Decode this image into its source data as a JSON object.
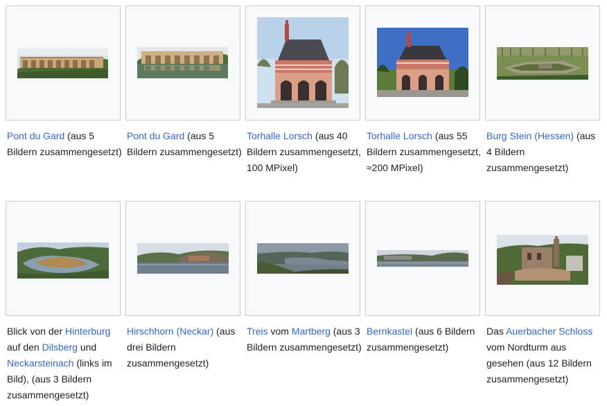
{
  "colors": {
    "link": "#3366cc",
    "text": "#202122",
    "thumb_bg": "#f8f9fa",
    "thumb_border": "#c8ccd1"
  },
  "gallery": {
    "items": [
      {
        "id": "pont-du-gard-5-a",
        "image": "pont-du-gard-panorama",
        "caption": {
          "link1": "Pont du Gard",
          "rest": " (aus 5 Bildern zusammengesetzt)"
        }
      },
      {
        "id": "pont-du-gard-5-b",
        "image": "pont-du-gard-panorama-reflection",
        "caption": {
          "link1": "Pont du Gard",
          "rest": " (aus 5 Bildern zusammengesetzt)"
        }
      },
      {
        "id": "torhalle-lorsch-40",
        "image": "torhalle-lorsch-photo",
        "caption": {
          "link1": "Torhalle Lorsch",
          "rest": " (aus 40 Bildern zusammengesetzt, 100 MPixel)"
        }
      },
      {
        "id": "torhalle-lorsch-55",
        "image": "torhalle-lorsch-photo-blue-sky",
        "caption": {
          "link1": "Torhalle Lorsch",
          "rest": " (aus 55 Bildern zusammengesetzt, ≈200 MPixel)"
        }
      },
      {
        "id": "burg-stein",
        "image": "burg-stein-ruins-panorama",
        "caption": {
          "link1": "Burg Stein (Hessen)",
          "rest": " (aus 4 Bildern zusammengesetzt)"
        }
      },
      {
        "id": "blick-hinterburg",
        "image": "neckar-bend-panorama",
        "caption": {
          "pre": "Blick von der ",
          "link1": "Hinterburg",
          "mid1": " auf den ",
          "link2": "Dilsberg",
          "mid2": " und ",
          "link3": "Neckarsteinach",
          "rest": " (links im Bild), (aus 3 Bildern zusammengesetzt)"
        }
      },
      {
        "id": "hirschhorn",
        "image": "hirschhorn-river-panorama",
        "caption": {
          "link1": "Hirschhorn (Neckar)",
          "rest": " (aus drei Bildern zusammengesetzt)"
        }
      },
      {
        "id": "treis",
        "image": "treis-valley-panorama",
        "caption": {
          "link1": "Treis",
          "mid1": " vom ",
          "link2": "Martberg",
          "rest": " (aus 3 Bildern zusammengesetzt)"
        }
      },
      {
        "id": "bernkastel",
        "image": "bernkastel-panorama",
        "caption": {
          "link1": "Bernkastel",
          "rest": " (aus 6 Bildern zusammengesetzt)"
        }
      },
      {
        "id": "auerbacher-schloss",
        "image": "auerbacher-schloss-panorama",
        "caption": {
          "pre": "Das ",
          "link1": "Auerbacher Schloss",
          "rest": " vom Nordturm aus gesehen (aus 12 Bildern zusammengesetzt)"
        }
      }
    ]
  }
}
